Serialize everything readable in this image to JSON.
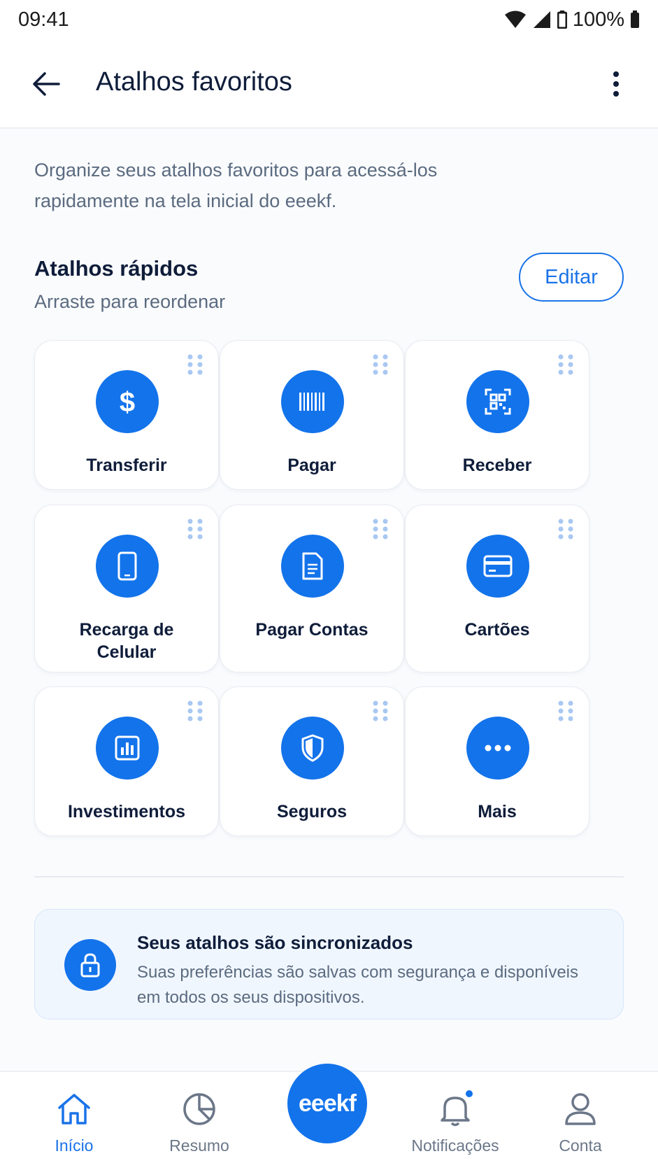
{
  "status_bar": {
    "time": "09:41",
    "battery": "100%"
  },
  "app_bar": {
    "title": "Atalhos favoritos"
  },
  "intro": {
    "text": "Organize seus atalhos favoritos para acessá-los rapidamente na tela inicial do eeekf."
  },
  "section": {
    "title": "Atalhos rápidos",
    "subtitle": "Arraste para reordenar",
    "edit_label": "Editar"
  },
  "shortcuts": [
    {
      "label": "Transferir",
      "icon": "dollar-icon"
    },
    {
      "label": "Pagar",
      "icon": "barcode-icon"
    },
    {
      "label": "Receber",
      "icon": "qr-code-icon"
    },
    {
      "label": "Recarga de Celular",
      "icon": "phone-icon"
    },
    {
      "label": "Pagar Contas",
      "icon": "document-icon"
    },
    {
      "label": "Cartões",
      "icon": "card-icon"
    },
    {
      "label": "Investimentos",
      "icon": "chart-icon"
    },
    {
      "label": "Seguros",
      "icon": "shield-icon"
    },
    {
      "label": "Mais",
      "icon": "more-icon"
    }
  ],
  "sync": {
    "title": "Seus atalhos são sincronizados",
    "text": "Suas preferências são salvas com segurança e disponíveis em todos os seus dispositivos."
  },
  "bottom_nav": {
    "items": [
      {
        "label": "Início",
        "icon": "home-icon",
        "active": true
      },
      {
        "label": "Resumo",
        "icon": "pie-chart-icon"
      },
      {
        "label": "Notificações",
        "icon": "bell-icon"
      },
      {
        "label": "Conta",
        "icon": "user-icon"
      }
    ],
    "fab_label": "eeekf"
  },
  "colors": {
    "accent": "#1373eb",
    "text": "#0f1d3a",
    "muted": "#5b6b80"
  }
}
